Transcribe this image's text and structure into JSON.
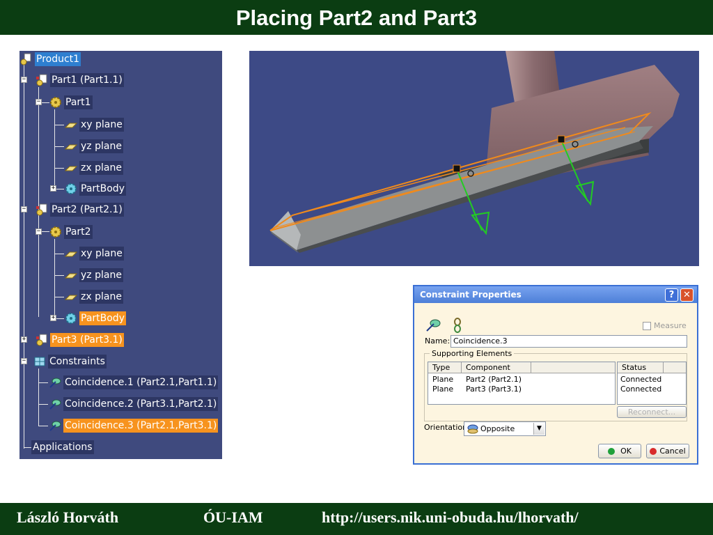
{
  "slide": {
    "title": "Placing Part2 and Part3",
    "footer_author": "László Horváth",
    "footer_institution": "ÓU-IAM",
    "footer_url": "http://users.nik.uni-obuda.hu/lhorvath/"
  },
  "tree": {
    "product": "Product1",
    "part1_instance": "Part1 (Part1.1)",
    "part1": "Part1",
    "part1_xy": "xy plane",
    "part1_yz": "yz plane",
    "part1_zx": "zx plane",
    "part1_body": "PartBody",
    "part2_instance": "Part2 (Part2.1)",
    "part2": "Part2",
    "part2_xy": "xy plane",
    "part2_yz": "yz plane",
    "part2_zx": "zx plane",
    "part2_body": "PartBody",
    "part3_instance": "Part3 (Part3.1)",
    "constraints": "Constraints",
    "coincidence_1": "Coincidence.1 (Part2.1,Part1.1)",
    "coincidence_2": "Coincidence.2 (Part3.1,Part2.1)",
    "coincidence_3": "Coincidence.3 (Part2.1,Part3.1)",
    "applications": "Applications"
  },
  "dialog": {
    "title": "Constraint Properties",
    "help_label": "?",
    "close_label": "✕",
    "measure_label": "Measure",
    "name_label": "Name:",
    "name_value": "Coincidence.3",
    "supporting_label": "Supporting Elements",
    "col_type": "Type",
    "col_component": "Component",
    "col_status": "Status",
    "rows": [
      {
        "type": "Plane",
        "component": "Part2 (Part2.1)",
        "status": "Connected"
      },
      {
        "type": "Plane",
        "component": "Part3 (Part3.1)",
        "status": "Connected"
      }
    ],
    "reconnect_label": "Reconnect...",
    "orientation_label": "Orientation",
    "orientation_value": "Opposite",
    "ok_label": "OK",
    "cancel_label": "Cancel"
  },
  "colors": {
    "slide_bar": "#0b3d12",
    "tree_bg": "#3f4a7e",
    "selection": "#f7931e",
    "viewport_bg": "#3d4a86",
    "constraint_edge": "#f08a1c",
    "normal_arrow": "#22cc22"
  }
}
